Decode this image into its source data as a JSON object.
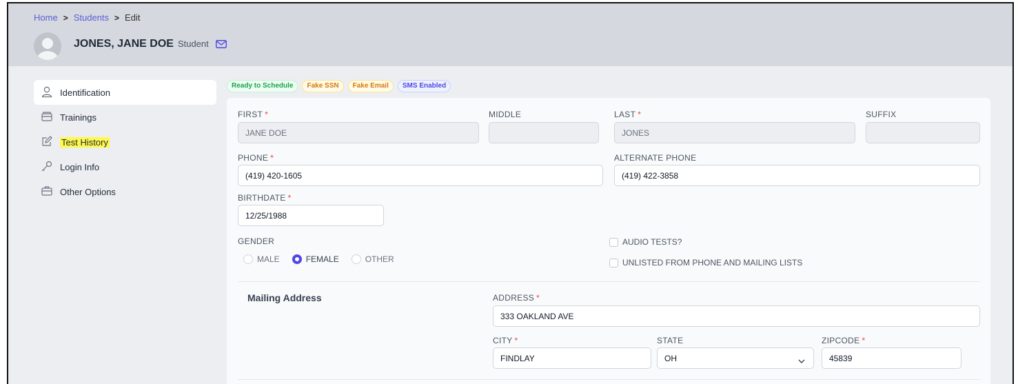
{
  "breadcrumb": {
    "home": "Home",
    "students": "Students",
    "current": "Edit"
  },
  "student": {
    "name": "JONES, JANE DOE",
    "role": "Student"
  },
  "sidebar": {
    "items": [
      {
        "label": "Identification",
        "icon": "user-icon"
      },
      {
        "label": "Trainings",
        "icon": "tray-icon"
      },
      {
        "label": "Test History",
        "icon": "pencil-icon"
      },
      {
        "label": "Login Info",
        "icon": "key-icon"
      },
      {
        "label": "Other Options",
        "icon": "briefcase-icon"
      }
    ]
  },
  "badges": [
    "Ready to Schedule",
    "Fake SSN",
    "Fake Email",
    "SMS Enabled"
  ],
  "colors": {
    "accent": "#4f46e5",
    "required": "#ef4444",
    "highlight": "#fff94d",
    "badge_green": "#16a34a",
    "badge_orange": "#d97706",
    "badge_blue": "#4f46e5"
  },
  "form": {
    "first": {
      "label": "FIRST",
      "value": "JANE DOE"
    },
    "middle": {
      "label": "MIDDLE",
      "value": ""
    },
    "last": {
      "label": "LAST",
      "value": "JONES"
    },
    "suffix": {
      "label": "SUFFIX",
      "value": ""
    },
    "phone": {
      "label": "PHONE",
      "value": "(419) 420-1605"
    },
    "alt_phone": {
      "label": "ALTERNATE PHONE",
      "value": "(419) 422-3858"
    },
    "birthdate": {
      "label": "BIRTHDATE",
      "value": "12/25/1988"
    },
    "gender": {
      "label": "GENDER",
      "options": [
        "MALE",
        "FEMALE",
        "OTHER"
      ],
      "selected": "FEMALE"
    },
    "audio_tests": {
      "label": "AUDIO TESTS?",
      "checked": false
    },
    "unlisted": {
      "label": "UNLISTED FROM PHONE AND MAILING LISTS",
      "checked": false
    }
  },
  "mailing": {
    "title": "Mailing Address",
    "address": {
      "label": "ADDRESS",
      "value": "333 OAKLAND AVE"
    },
    "city": {
      "label": "CITY",
      "value": "FINDLAY"
    },
    "state": {
      "label": "STATE",
      "value": "OH"
    },
    "zipcode": {
      "label": "ZIPCODE",
      "value": "45839"
    }
  }
}
